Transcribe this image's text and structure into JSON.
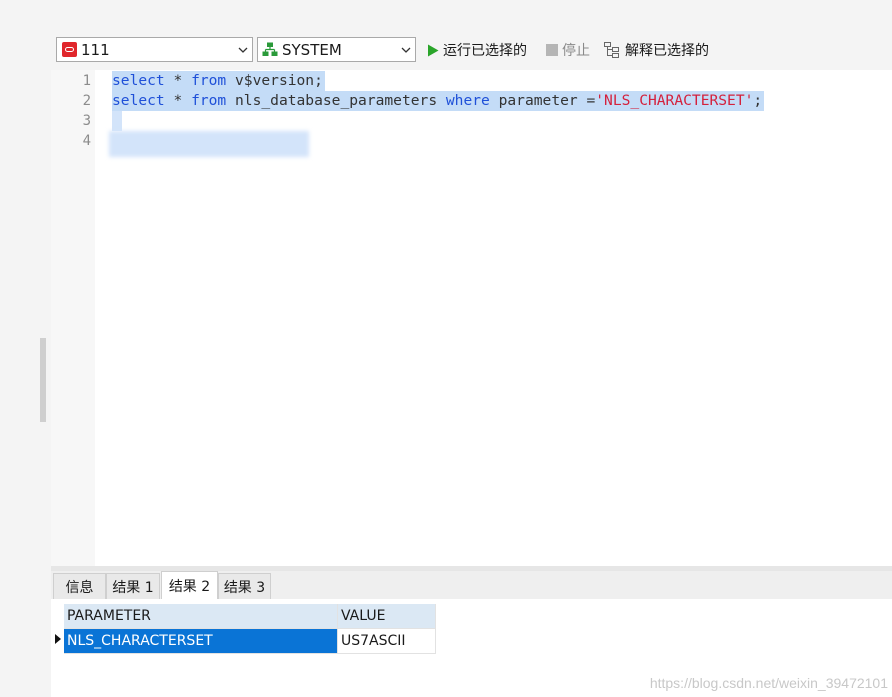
{
  "toolbar": {
    "connection": "111",
    "schema": "SYSTEM",
    "run_selected": "运行已选择的",
    "stop": "停止",
    "explain_selected": "解释已选择的"
  },
  "editor": {
    "line_numbers": [
      "1",
      "2",
      "3",
      "4"
    ],
    "lines": [
      {
        "parts": [
          "select",
          " * ",
          "from",
          " v$version;"
        ]
      },
      {
        "parts": [
          "select",
          " * ",
          "from",
          " nls_database_parameters ",
          "where",
          " parameter =",
          "'NLS_CHARACTERSET'",
          ";"
        ]
      }
    ]
  },
  "result_tabs": [
    "信息",
    "结果 1",
    "结果 2",
    "结果 3"
  ],
  "active_tab": "结果 2",
  "grid": {
    "columns": [
      "PARAMETER",
      "VALUE"
    ],
    "rows": [
      [
        "NLS_CHARACTERSET",
        "US7ASCII"
      ]
    ]
  },
  "watermark": "https://blog.csdn.net/weixin_39472101",
  "colors": {
    "keyword": "#1f50d8",
    "string": "#d4213c",
    "selection": "#c4dcf7",
    "selected_cell": "#0a74d6",
    "header_cell": "#dbe8f4",
    "run_icon": "#2aa52a",
    "connection_icon": "#e0262b"
  },
  "icons": {
    "connection": "oracle-connection-icon",
    "schema": "schema-tree-icon",
    "run": "play-icon",
    "stop": "stop-icon",
    "explain": "explain-plan-icon",
    "dropdown": "chevron-down-icon"
  }
}
